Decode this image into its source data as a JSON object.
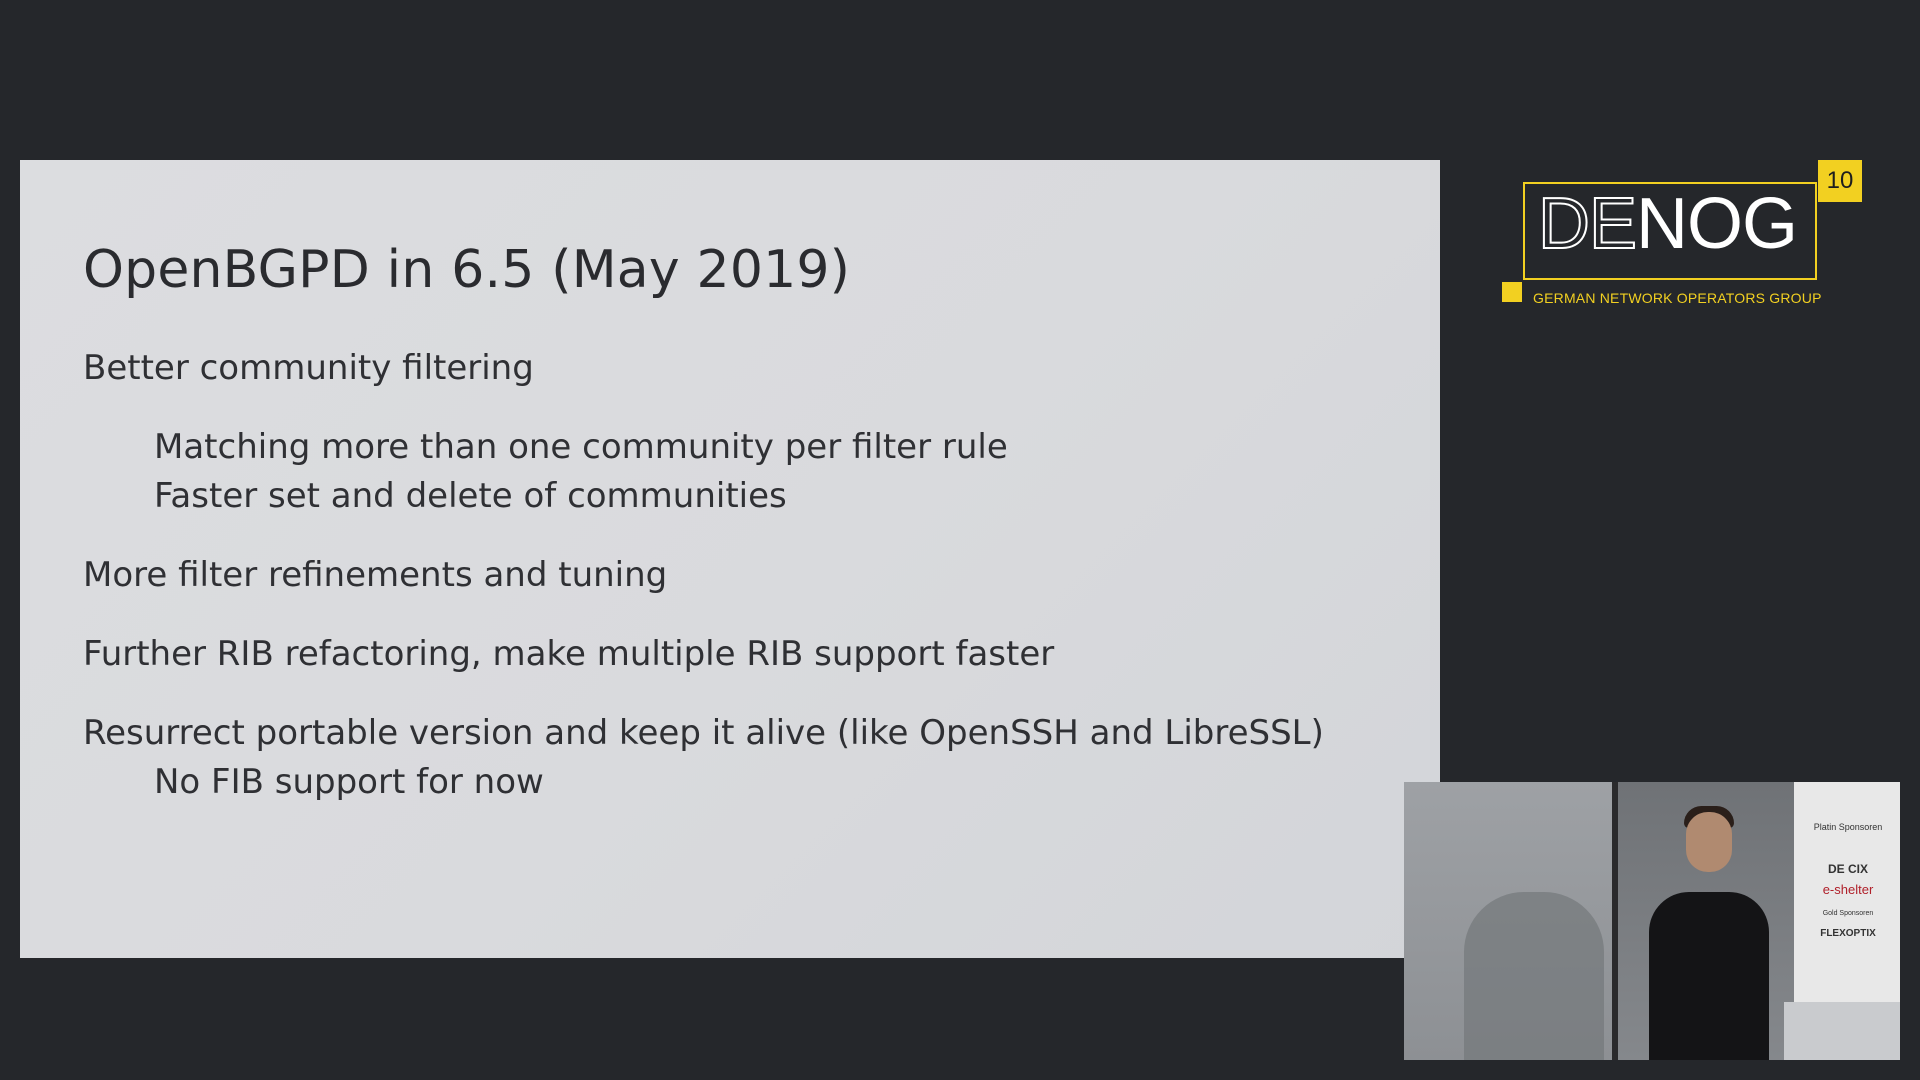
{
  "slide": {
    "title": "OpenBGPD in 6.5 (May 2019)",
    "bullets": [
      {
        "text": "Better community filtering",
        "subs": [
          "Matching more than one community per filter rule",
          "Faster set and delete of communities"
        ]
      },
      {
        "text": "More filter refinements and tuning",
        "subs": []
      },
      {
        "text": "Further RIB refactoring, make multiple RIB support faster",
        "subs": []
      },
      {
        "text": "Resurrect portable version and keep it alive (like OpenSSH and LibreSSL)",
        "subs": [
          "No FIB support for now"
        ]
      }
    ]
  },
  "logo": {
    "word_light": "DE",
    "word_bold": "NOG",
    "badge": "10",
    "subtitle": "GERMAN NETWORK OPERATORS GROUP"
  },
  "webcam": {
    "banner": {
      "platin": "Platin Sponsoren",
      "decix": "DE CIX",
      "eshelter": "e-shelter",
      "gold": "Gold Sponsoren",
      "flexoptix": "FLEXOPTIX"
    }
  },
  "colors": {
    "background": "#25272b",
    "slide": "#dcdde0",
    "accent": "#f2d021"
  }
}
